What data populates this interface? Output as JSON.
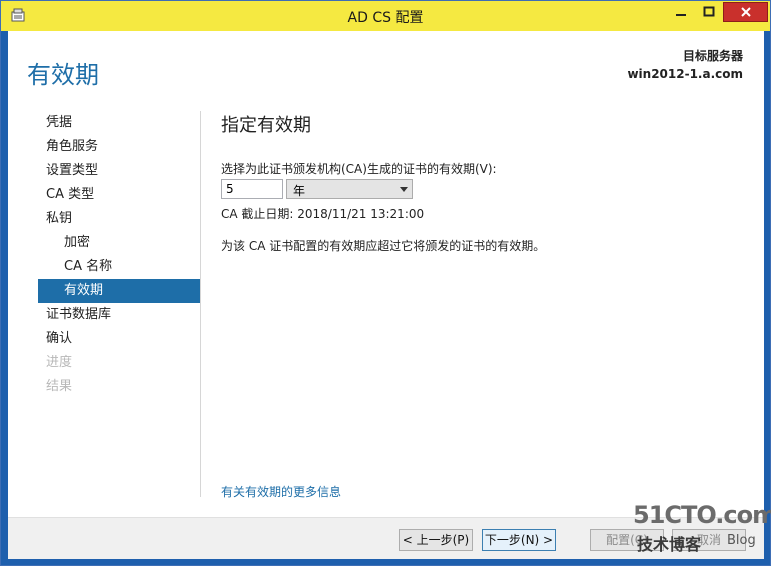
{
  "window": {
    "title": "AD CS 配置"
  },
  "header": {
    "page_title": "有效期",
    "destination_label": "目标服务器",
    "destination_server": "win2012-1.a.com"
  },
  "nav": {
    "items": [
      {
        "label": "凭据",
        "state": "normal"
      },
      {
        "label": "角色服务",
        "state": "normal"
      },
      {
        "label": "设置类型",
        "state": "normal"
      },
      {
        "label": "CA 类型",
        "state": "normal"
      },
      {
        "label": "私钥",
        "state": "normal"
      },
      {
        "label": "加密",
        "state": "normal",
        "sub": true
      },
      {
        "label": "CA 名称",
        "state": "normal",
        "sub": true
      },
      {
        "label": "有效期",
        "state": "active",
        "sub": true
      },
      {
        "label": "证书数据库",
        "state": "normal"
      },
      {
        "label": "确认",
        "state": "normal"
      },
      {
        "label": "进度",
        "state": "disabled"
      },
      {
        "label": "结果",
        "state": "disabled"
      }
    ]
  },
  "main": {
    "heading": "指定有效期",
    "prompt": "选择为此证书颁发机构(CA)生成的证书的有效期(V):",
    "validity_value": "5",
    "unit_selected": "年",
    "end_date": "CA 截止日期: 2018/11/21 13:21:00",
    "note": "为该 CA 证书配置的有效期应超过它将颁发的证书的有效期。",
    "more_info_link": "有关有效期的更多信息"
  },
  "footer": {
    "prev_label": "< 上一步(P)",
    "next_label": "下一步(N) >",
    "config_label": "配置(C)",
    "cancel_label": "取消"
  },
  "watermark": {
    "line1": "51CTO.com",
    "line2": "技术博客",
    "line3": "Blog"
  },
  "colors": {
    "accent": "#1e6ea8",
    "titlebar": "#f5e941",
    "close_button": "#c9302c"
  }
}
